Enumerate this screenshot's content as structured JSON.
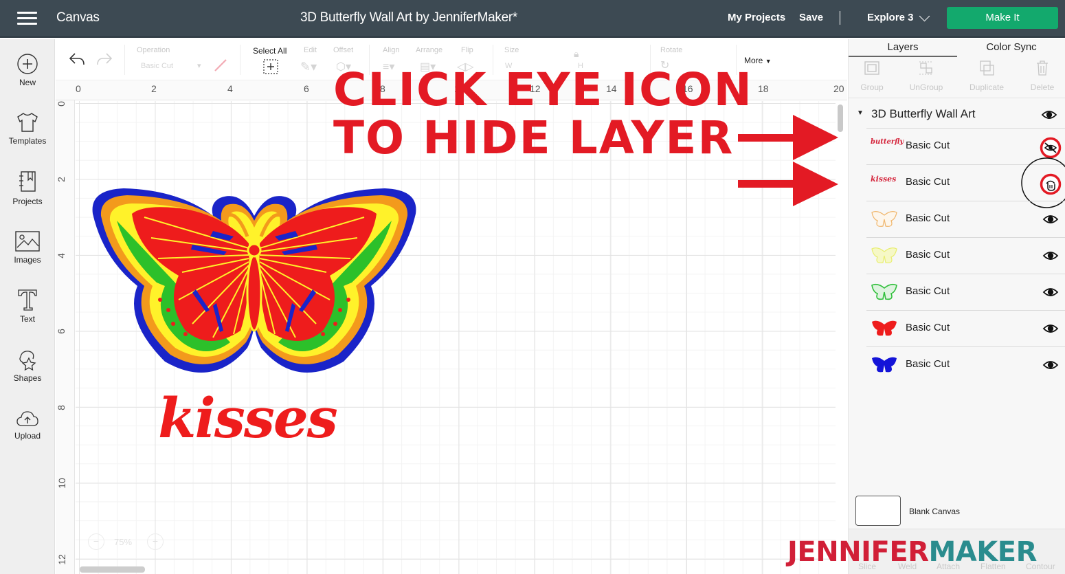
{
  "header": {
    "app_name": "Canvas",
    "document_title": "3D Butterfly Wall Art by JenniferMaker*",
    "my_projects": "My Projects",
    "save": "Save",
    "machine": "Explore 3",
    "make_it": "Make It",
    "accent_color": "#13a96d"
  },
  "sidebar": {
    "items": [
      {
        "label": "New",
        "icon": "plus-circle-icon"
      },
      {
        "label": "Templates",
        "icon": "tshirt-icon"
      },
      {
        "label": "Projects",
        "icon": "notebook-icon"
      },
      {
        "label": "Images",
        "icon": "image-icon"
      },
      {
        "label": "Text",
        "icon": "text-t-icon"
      },
      {
        "label": "Shapes",
        "icon": "shapes-icon"
      },
      {
        "label": "Upload",
        "icon": "cloud-upload-icon"
      }
    ]
  },
  "toolbar": {
    "operation_label": "Operation",
    "operation_value": "Basic Cut",
    "select_all": "Select All",
    "edit": "Edit",
    "offset": "Offset",
    "align": "Align",
    "arrange": "Arrange",
    "flip": "Flip",
    "size": "Size",
    "size_w": "W",
    "size_h": "H",
    "rotate": "Rotate",
    "more": "More"
  },
  "rulers": {
    "top": [
      "0",
      "2",
      "4",
      "6",
      "8",
      "10",
      "12",
      "14",
      "16",
      "18",
      "20"
    ],
    "left": [
      "0",
      "2",
      "4",
      "6",
      "8",
      "10",
      "12"
    ]
  },
  "canvas": {
    "zoom_value": "75%",
    "kisses_text": "kisses"
  },
  "annotation": {
    "line1": "CLICK EYE ICON",
    "line2": "TO HIDE LAYER",
    "color": "#e31a24"
  },
  "layers_panel": {
    "tabs": [
      "Layers",
      "Color Sync"
    ],
    "active_tab": "Layers",
    "actions": [
      "Group",
      "UnGroup",
      "Duplicate",
      "Delete"
    ],
    "group_name": "3D Butterfly Wall Art",
    "layers": [
      {
        "name": "Basic Cut",
        "thumb": "butterfly",
        "thumb_color": "#d4233a",
        "visible": false,
        "eye_state": "hidden"
      },
      {
        "name": "Basic Cut",
        "thumb": "kisses",
        "thumb_color": "#d4233a",
        "visible": true,
        "eye_state": "hover"
      },
      {
        "name": "Basic Cut",
        "thumb": "butterfly-outline",
        "thumb_color": "#f0b56a",
        "visible": true,
        "eye_state": "visible"
      },
      {
        "name": "Basic Cut",
        "thumb": "butterfly-outline",
        "thumb_color": "#e8ee70",
        "visible": true,
        "eye_state": "visible"
      },
      {
        "name": "Basic Cut",
        "thumb": "butterfly-outline",
        "thumb_color": "#2fbf3a",
        "visible": true,
        "eye_state": "visible"
      },
      {
        "name": "Basic Cut",
        "thumb": "butterfly-solid",
        "thumb_color": "#ee1c1c",
        "visible": true,
        "eye_state": "visible"
      },
      {
        "name": "Basic Cut",
        "thumb": "butterfly-solid",
        "thumb_color": "#1414d8",
        "visible": true,
        "eye_state": "visible"
      }
    ],
    "blank_canvas": "Blank Canvas",
    "bottom_actions": [
      "Slice",
      "Weld",
      "Attach",
      "Flatten",
      "Contour"
    ]
  },
  "brand": {
    "part1": "JENNIFER",
    "part2": "MAKER"
  }
}
